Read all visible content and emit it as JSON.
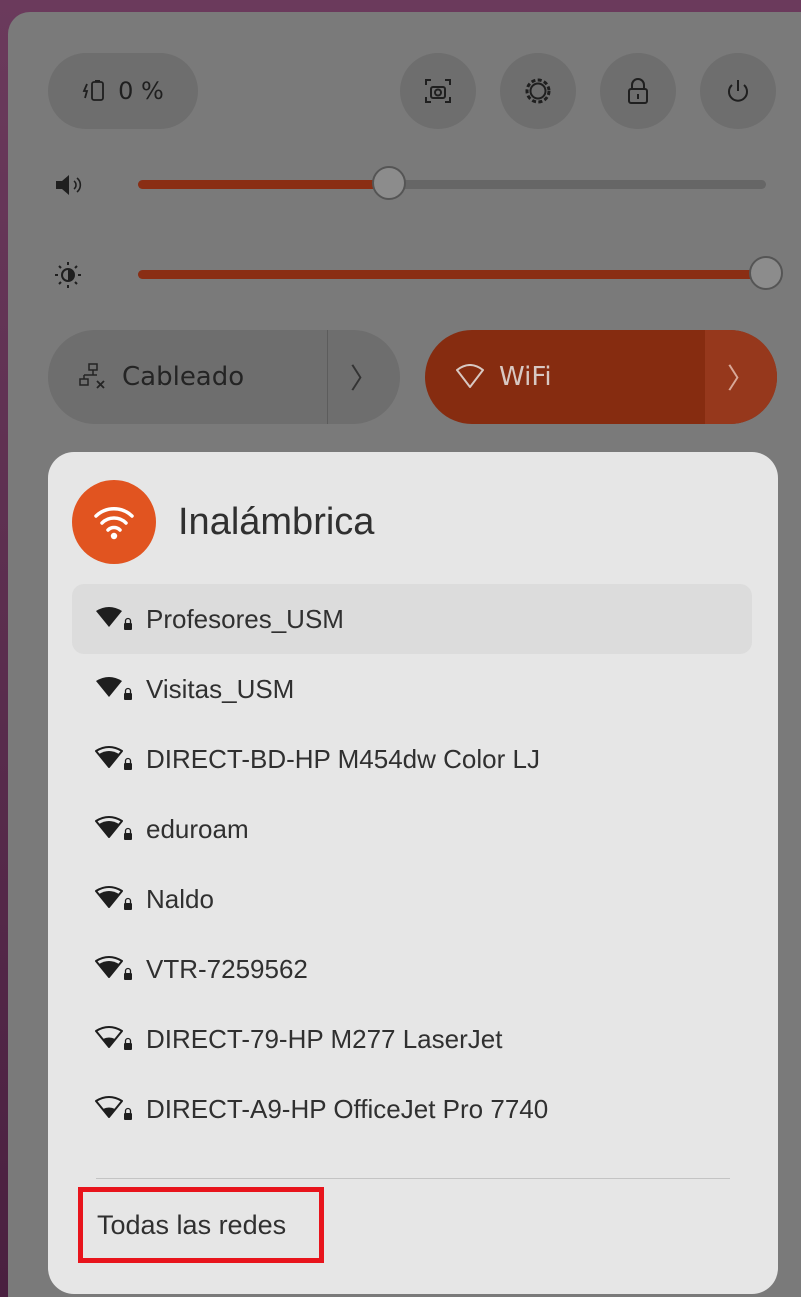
{
  "quick_settings": {
    "battery": {
      "icon": "battery-charging-icon",
      "label": "0 %"
    },
    "buttons": [
      {
        "name": "screenshot-button",
        "icon": "screenshot-icon"
      },
      {
        "name": "settings-button",
        "icon": "gear-icon"
      },
      {
        "name": "lock-button",
        "icon": "lock-icon"
      },
      {
        "name": "power-button",
        "icon": "power-icon"
      }
    ],
    "volume": {
      "icon": "speaker-icon",
      "level": 0.4
    },
    "brightness": {
      "icon": "brightness-icon",
      "level": 1.0
    },
    "wired": {
      "icon": "wired-network-disconnected-icon",
      "label": "Cableado",
      "arrow": "〉"
    },
    "wifi": {
      "icon": "wifi-outline-icon",
      "label": "WiFi",
      "arrow": "〉",
      "active": true
    }
  },
  "wireless_menu": {
    "icon": "wifi-icon",
    "title": "Inalámbrica",
    "networks": [
      {
        "name": "Profesores_USM",
        "signal": "full",
        "secured": true
      },
      {
        "name": "Visitas_USM",
        "signal": "full",
        "secured": true
      },
      {
        "name": "DIRECT-BD-HP M454dw Color LJ",
        "signal": "good",
        "secured": true
      },
      {
        "name": "eduroam",
        "signal": "good",
        "secured": true
      },
      {
        "name": "Naldo",
        "signal": "good",
        "secured": true
      },
      {
        "name": "VTR-7259562",
        "signal": "good",
        "secured": true
      },
      {
        "name": "DIRECT-79-HP M277 LaserJet",
        "signal": "weak",
        "secured": true
      },
      {
        "name": "DIRECT-A9-HP OfficeJet Pro 7740",
        "signal": "weak",
        "secured": true
      }
    ],
    "all_networks_label": "Todas las redes"
  },
  "colors": {
    "accent": "#e15420",
    "wifi_toggle": "#862c10",
    "highlight_box": "#e8141c"
  }
}
